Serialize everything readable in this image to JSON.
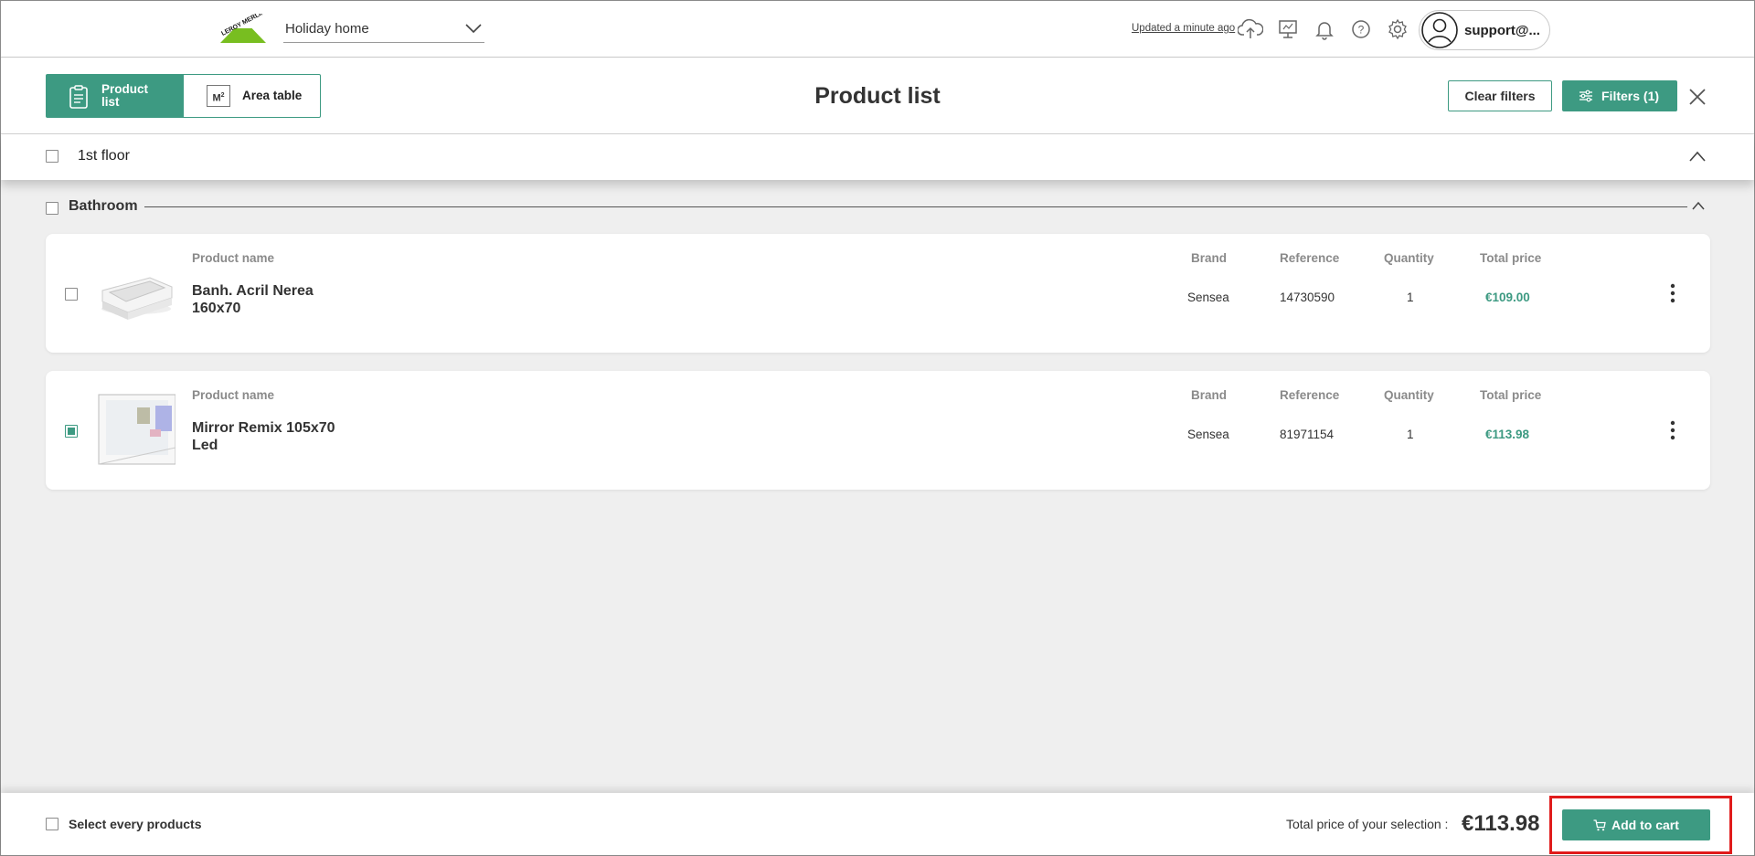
{
  "topbar": {
    "logo_text": "LEROY MERLIN",
    "project_name": "Holiday home",
    "updated_text": "Updated a minute ago",
    "user_name": "support@..."
  },
  "header": {
    "tabs": [
      {
        "label": "Product list",
        "active": true
      },
      {
        "label": "Area table",
        "active": false,
        "icon_text": "M²"
      }
    ],
    "title": "Product list",
    "clear_filters_label": "Clear filters",
    "filters_label": "Filters (1)"
  },
  "floor": {
    "label": "1st floor",
    "checked": false
  },
  "room": {
    "label": "Bathroom",
    "checked": false
  },
  "columns": {
    "product_name": "Product name",
    "brand": "Brand",
    "reference": "Reference",
    "quantity": "Quantity",
    "total_price": "Total price"
  },
  "products": [
    {
      "name": "Banh. Acril Nerea 160x70",
      "brand": "Sensea",
      "reference": "14730590",
      "quantity": "1",
      "total_price": "€109.00",
      "checked": false
    },
    {
      "name": "Mirror Remix 105x70 Led",
      "brand": "Sensea",
      "reference": "81971154",
      "quantity": "1",
      "total_price": "€113.98",
      "checked": true
    }
  ],
  "footer": {
    "select_all_label": "Select every products",
    "total_label": "Total price of your selection :",
    "total_value": "€113.98",
    "add_to_cart_label": "Add to cart"
  },
  "colors": {
    "accent": "#3d9a82",
    "highlight": "#e01b1b",
    "background": "#efefef"
  }
}
